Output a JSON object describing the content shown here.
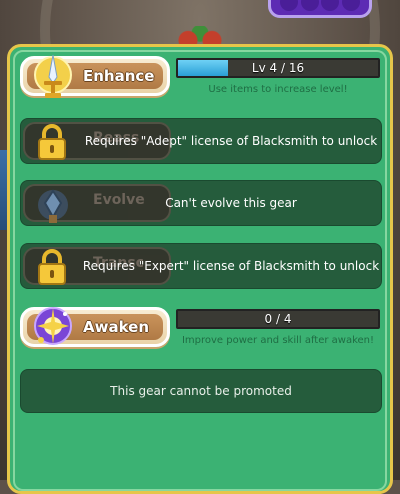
{
  "enhance": {
    "label": "Enhance",
    "level_text": "Lv 4 / 16",
    "level_current": 4,
    "level_max": 16,
    "hint": "Use items to increase level!",
    "icon": "sword-trophy-icon"
  },
  "reassemble": {
    "ghost_label": "Reass",
    "message": "Requires \"Adept\" license of Blacksmith to unlock",
    "icon": "padlock-icon"
  },
  "evolve": {
    "ghost_label": "Evolve",
    "message": "Can't evolve this gear",
    "icon": "evolve-gem-icon"
  },
  "transcend": {
    "ghost_label": "Transc",
    "message": "Requires \"Expert\" license of Blacksmith to unlock",
    "icon": "padlock-icon"
  },
  "awaken": {
    "label": "Awaken",
    "progress_text": "0 / 4",
    "progress_current": 0,
    "progress_max": 4,
    "hint": "Improve power and skill after awaken!",
    "icon": "awaken-sparkle-icon"
  },
  "promote": {
    "message": "This gear cannot be promoted"
  },
  "colors": {
    "panel": "#3bb273",
    "panel_border": "#e6c64a",
    "locked_bg": "#255c3c",
    "bar_fill": "#2a9fd6",
    "button_brown": "#b07a45"
  }
}
